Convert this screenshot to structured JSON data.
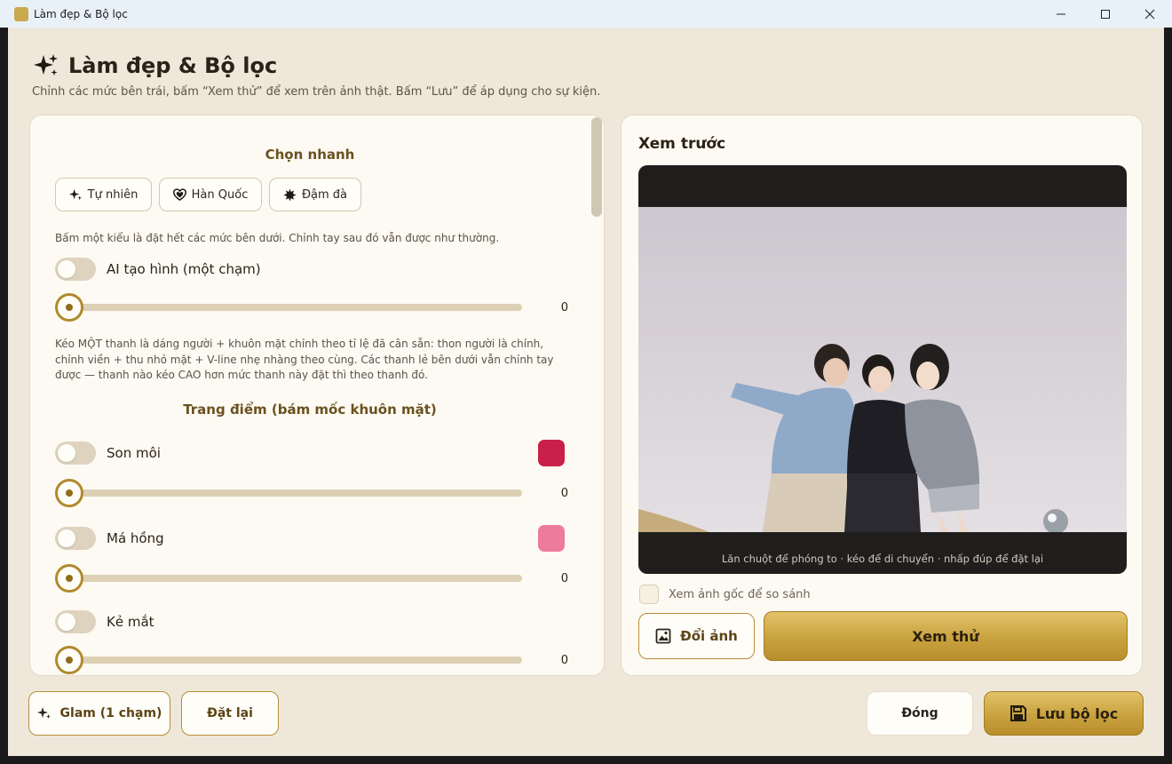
{
  "window": {
    "title": "Làm đẹp & Bộ lọc"
  },
  "header": {
    "title": "Làm đẹp & Bộ lọc",
    "subtitle": "Chỉnh các mức bên trái, bấm “Xem thử” để xem trên ảnh thật. Bấm “Lưu” để áp dụng cho sự kiện."
  },
  "quick": {
    "title": "Chọn nhanh",
    "presets": [
      {
        "label": "Tự nhiên",
        "icon": "sparkle-icon"
      },
      {
        "label": "Hàn Quốc",
        "icon": "heart-icon"
      },
      {
        "label": "Đậm đà",
        "icon": "burst-icon"
      }
    ],
    "note": "Bấm một kiểu là đặt hết các mức bên dưới. Chỉnh tay sau đó vẫn được như thường."
  },
  "ai_shape": {
    "label": "AI tạo hình (một chạm)",
    "enabled": false,
    "value": "0",
    "note": "Kéo MỘT thanh là dáng người + khuôn mặt chỉnh theo tỉ lệ đã cân sẵn: thon người là chính, chỉnh viền + thu nhỏ mặt + V-line nhẹ nhàng theo cùng. Các thanh lẻ bên dưới vẫn chỉnh tay được — thanh nào kéo CAO hơn mức thanh này đặt thì theo thanh đó."
  },
  "makeup": {
    "title": "Trang điểm (bám mốc khuôn mặt)",
    "items": [
      {
        "label": "Son môi",
        "enabled": false,
        "value": "0",
        "color": "#c8204b"
      },
      {
        "label": "Má hồng",
        "enabled": false,
        "value": "0",
        "color": "#ee7b9b"
      },
      {
        "label": "Kẻ mắt",
        "enabled": false,
        "value": "0"
      }
    ]
  },
  "preview": {
    "title": "Xem trước",
    "hint": "Lăn chuột để phóng to · kéo để di chuyển · nhấp đúp để đặt lại",
    "compare_label": "Xem ảnh gốc để so sánh",
    "compare_checked": false,
    "change_photo_label": "Đổi ảnh",
    "try_label": "Xem thử"
  },
  "footer": {
    "glam_label": "Glam (1 chạm)",
    "reset_label": "Đặt lại",
    "close_label": "Đóng",
    "save_label": "Lưu bộ lọc"
  },
  "colors": {
    "accent": "#b08a2e",
    "background": "#efe8da",
    "panel": "#fdfaf3"
  }
}
